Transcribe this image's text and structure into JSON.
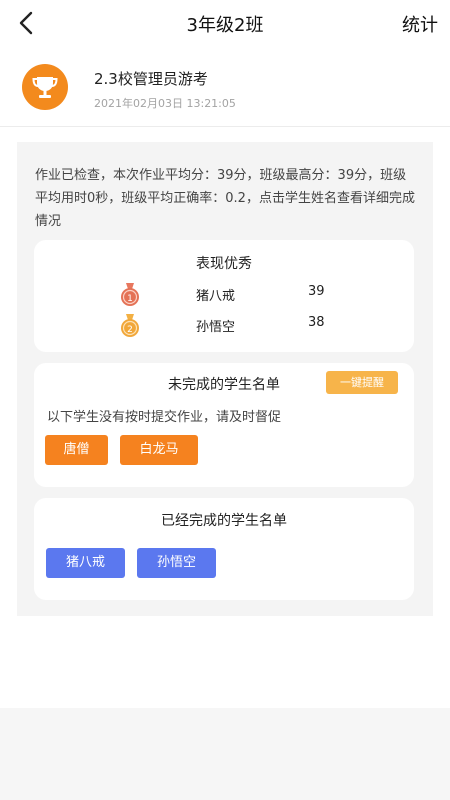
{
  "nav": {
    "back_icon": "chevron-left-icon",
    "title": "3年级2班",
    "right_label": "统计"
  },
  "homework": {
    "icon": "trophy-icon",
    "icon_color": "#f38a1d",
    "title": "2.3校管理员游考",
    "time": "2021年02月03日 13:21:05"
  },
  "summary": "作业已检查，本次作业平均分：39分，班级最高分：39分，班级平均用时0秒，班级平均正确率：0.2，点击学生姓名查看详细完成情况",
  "excellent": {
    "title": "表现优秀",
    "students": [
      {
        "rank": "1",
        "name": "猪八戒",
        "score": "39",
        "medal_icon": "gold-medal-icon"
      },
      {
        "rank": "2",
        "name": "孙悟空",
        "score": "38",
        "medal_icon": "silver-medal-icon"
      }
    ]
  },
  "unfinished": {
    "title": "未完成的学生名单",
    "remind_button": "一键提醒",
    "note": "以下学生没有按时提交作业，请及时督促",
    "students": [
      "唐僧",
      "白龙马"
    ],
    "chip_color": "#f5821f"
  },
  "finished": {
    "title": "已经完成的学生名单",
    "students": [
      "猪八戒",
      "孙悟空"
    ],
    "chip_color": "#5b78ef"
  }
}
